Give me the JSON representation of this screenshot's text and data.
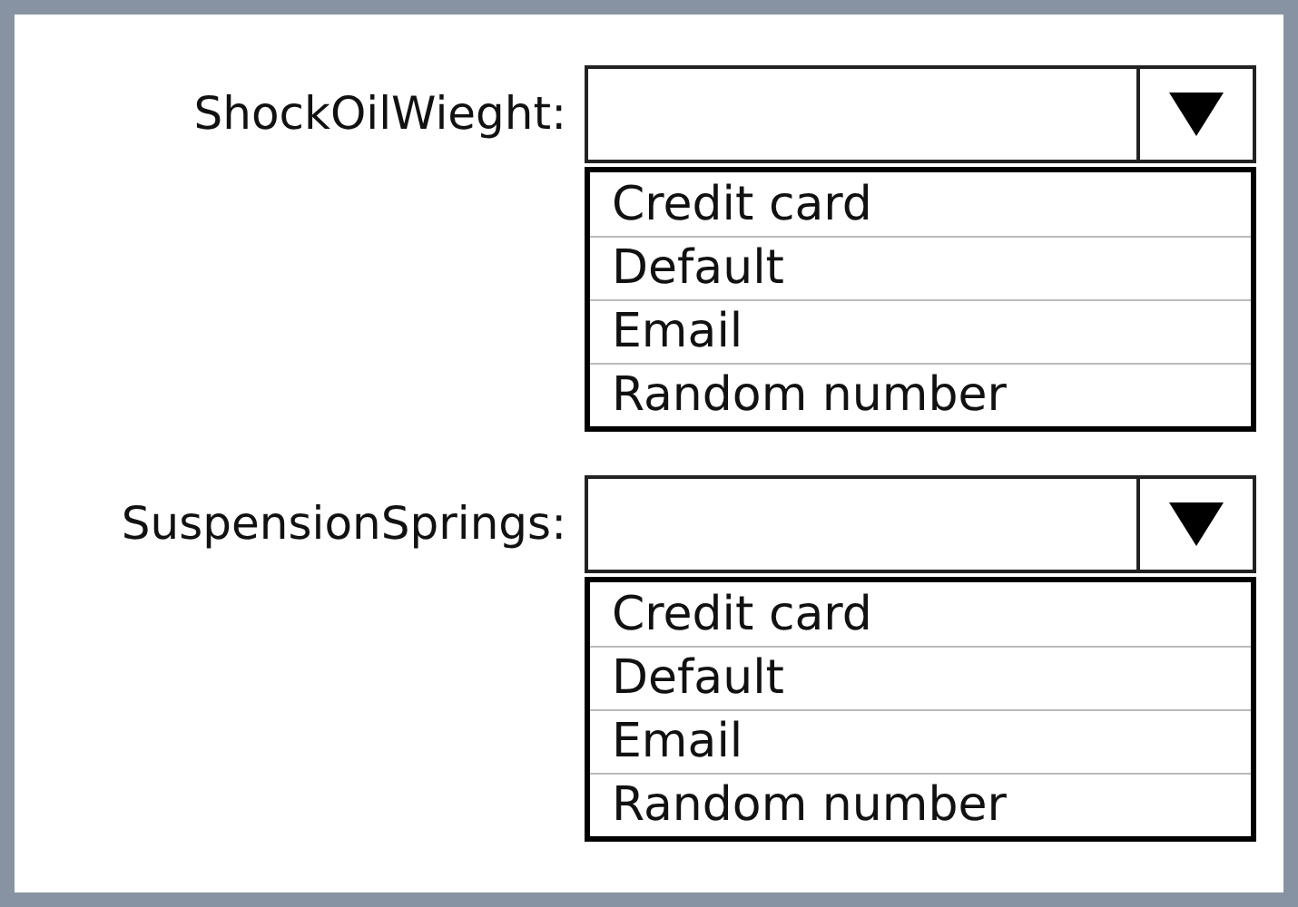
{
  "fields": [
    {
      "label": "ShockOilWieght:",
      "options": [
        "Credit card",
        "Default",
        "Email",
        "Random number"
      ]
    },
    {
      "label": "SuspensionSprings:",
      "options": [
        "Credit card",
        "Default",
        "Email",
        "Random number"
      ]
    }
  ]
}
